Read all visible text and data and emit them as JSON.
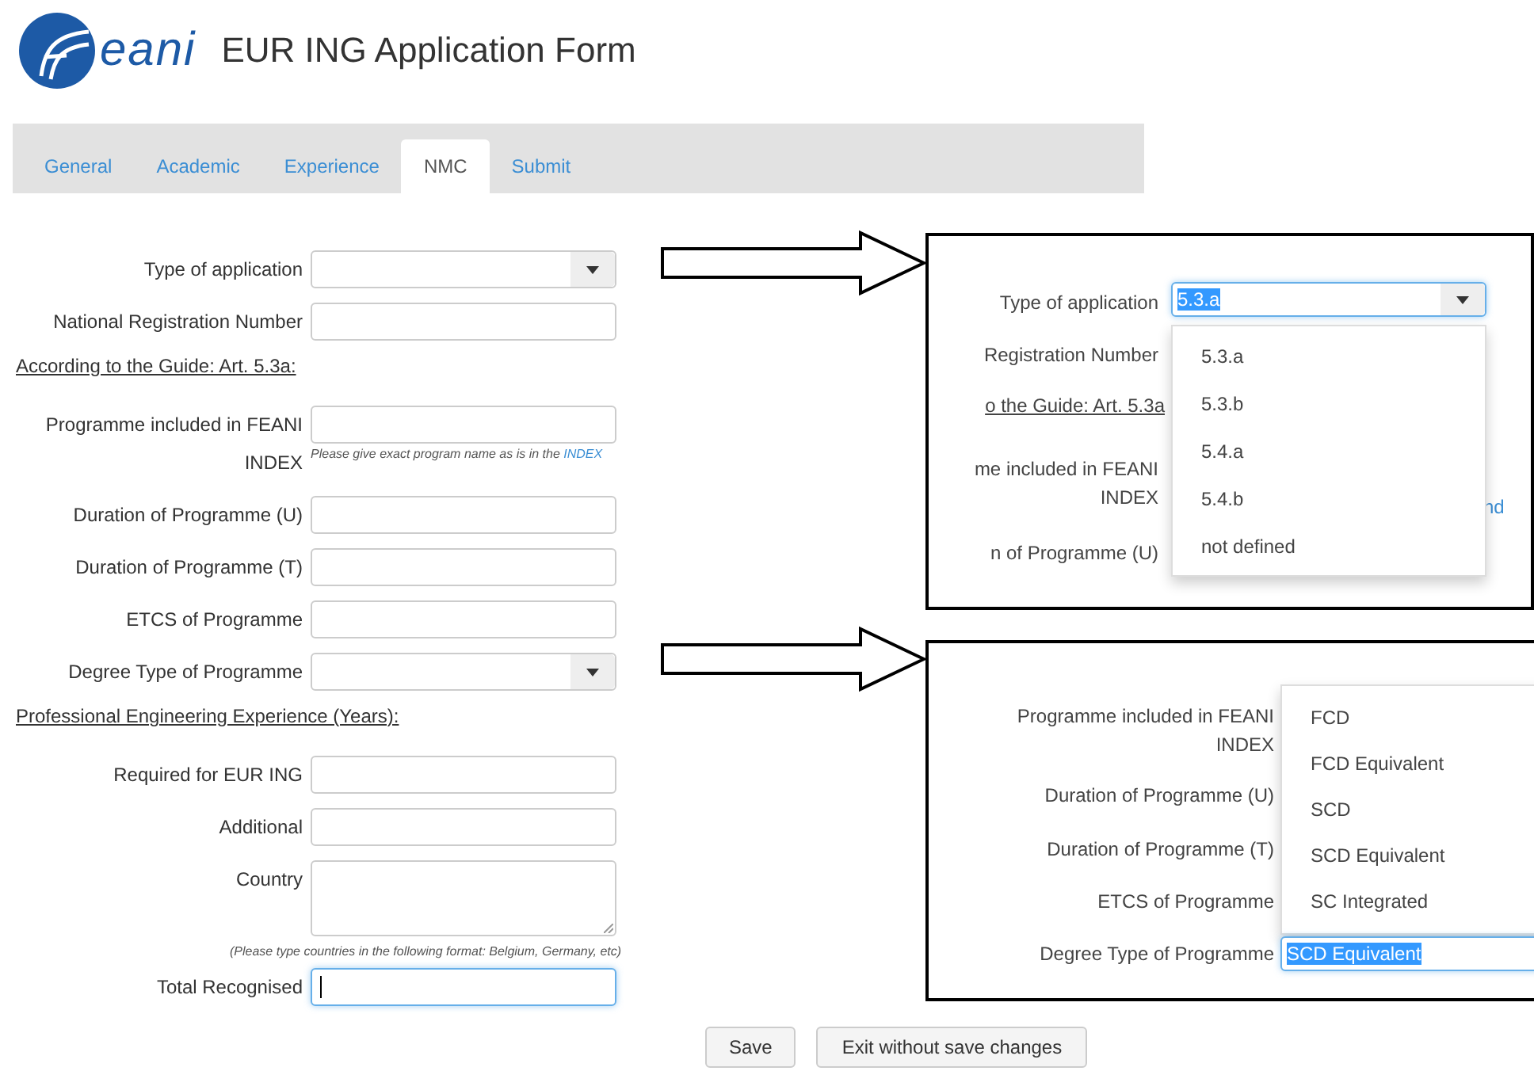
{
  "header": {
    "logo_text": "eani",
    "title": "EUR ING Application Form"
  },
  "tabs": [
    {
      "label": "General",
      "selected": false
    },
    {
      "label": "Academic",
      "selected": false
    },
    {
      "label": "Experience",
      "selected": false
    },
    {
      "label": "NMC",
      "selected": true
    },
    {
      "label": "Submit",
      "selected": false
    }
  ],
  "form": {
    "fields": [
      {
        "kind": "select",
        "label": "Type of application",
        "focused": false
      },
      {
        "kind": "text",
        "label": "National Registration Number",
        "focused": false
      },
      {
        "kind": "heading",
        "label": "According to the Guide: Art. 5.3a:"
      },
      {
        "kind": "text",
        "label": "Programme included in FEANI INDEX",
        "hint": "Please give exact program name as is in the",
        "hint_link": "INDEX",
        "focused": false
      },
      {
        "kind": "text",
        "label": "Duration of Programme (U)",
        "focused": false
      },
      {
        "kind": "text",
        "label": "Duration of Programme (T)",
        "focused": false
      },
      {
        "kind": "text",
        "label": "ETCS of Programme",
        "focused": false
      },
      {
        "kind": "select",
        "label": "Degree Type of Programme",
        "focused": false
      },
      {
        "kind": "heading",
        "label": "Professional Engineering Experience (Years):"
      },
      {
        "kind": "text",
        "label": "Required for EUR ING",
        "focused": false
      },
      {
        "kind": "text",
        "label": "Additional",
        "focused": false
      },
      {
        "kind": "textarea",
        "label": "Country",
        "note": "(Please type countries in the following format: Belgium, Germany, etc)",
        "focused": false
      },
      {
        "kind": "text",
        "label": "Total Recognised",
        "focused": true
      }
    ]
  },
  "buttons": [
    "Save",
    "Exit without save changes"
  ],
  "callouts": [
    {
      "kind": "list_below",
      "select_label": "Type of application",
      "value": "5.3.a",
      "labels": [
        {
          "kind": "label",
          "text": "Registration Number"
        },
        {
          "kind": "heading",
          "text": "o the Guide: Art. 5.3a"
        },
        {
          "kind": "label",
          "text": "me included in FEANI INDEX"
        },
        {
          "kind": "label",
          "text": "n of Programme (U)"
        }
      ],
      "link_fragment": "nd",
      "options": [
        "5.3.a",
        "5.3.b",
        "5.4.a",
        "5.4.b",
        "not defined"
      ]
    },
    {
      "kind": "list_above",
      "select_label": "Degree Type of Programme",
      "value": "SCD Equivalent",
      "labels": [
        "Programme included in FEANI INDEX",
        "Duration of Programme (U)",
        "Duration of Programme (T)",
        "ETCS of Programme"
      ],
      "options": [
        "FCD",
        "FCD Equivalent",
        "SCD",
        "SCD Equivalent",
        "SC Integrated"
      ]
    }
  ]
}
